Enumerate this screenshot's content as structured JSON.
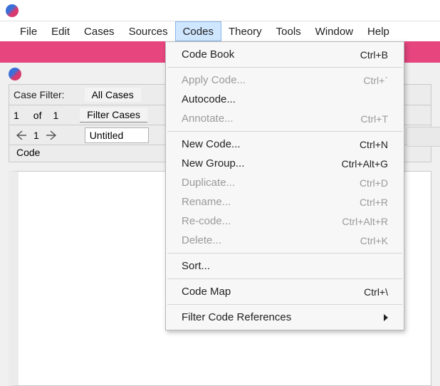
{
  "menubar": {
    "items": [
      "File",
      "Edit",
      "Cases",
      "Sources",
      "Codes",
      "Theory",
      "Tools",
      "Window",
      "Help"
    ],
    "active": "Codes"
  },
  "panel": {
    "case_filter_label": "Case Filter:",
    "all_cases": "All Cases",
    "page_current": "1",
    "page_of": "of",
    "page_total": "1",
    "filter_cases": "Filter Cases",
    "nav_number": "1",
    "untitled": "Untitled",
    "code_header": "Code"
  },
  "dropdown": {
    "groups": [
      [
        {
          "label": "Code Book",
          "shortcut": "Ctrl+B",
          "disabled": false
        }
      ],
      [
        {
          "label": "Apply Code...",
          "shortcut": "Ctrl+`",
          "disabled": true
        },
        {
          "label": "Autocode...",
          "shortcut": "",
          "disabled": false
        },
        {
          "label": "Annotate...",
          "shortcut": "Ctrl+T",
          "disabled": true
        }
      ],
      [
        {
          "label": "New Code...",
          "shortcut": "Ctrl+N",
          "disabled": false
        },
        {
          "label": "New Group...",
          "shortcut": "Ctrl+Alt+G",
          "disabled": false
        },
        {
          "label": "Duplicate...",
          "shortcut": "Ctrl+D",
          "disabled": true
        },
        {
          "label": "Rename...",
          "shortcut": "Ctrl+R",
          "disabled": true
        },
        {
          "label": "Re-code...",
          "shortcut": "Ctrl+Alt+R",
          "disabled": true
        },
        {
          "label": "Delete...",
          "shortcut": "Ctrl+K",
          "disabled": true
        }
      ],
      [
        {
          "label": "Sort...",
          "shortcut": "",
          "disabled": false
        }
      ],
      [
        {
          "label": "Code Map",
          "shortcut": "Ctrl+\\",
          "disabled": false
        }
      ],
      [
        {
          "label": "Filter Code References",
          "shortcut": "",
          "disabled": false,
          "submenu": true
        }
      ]
    ]
  }
}
